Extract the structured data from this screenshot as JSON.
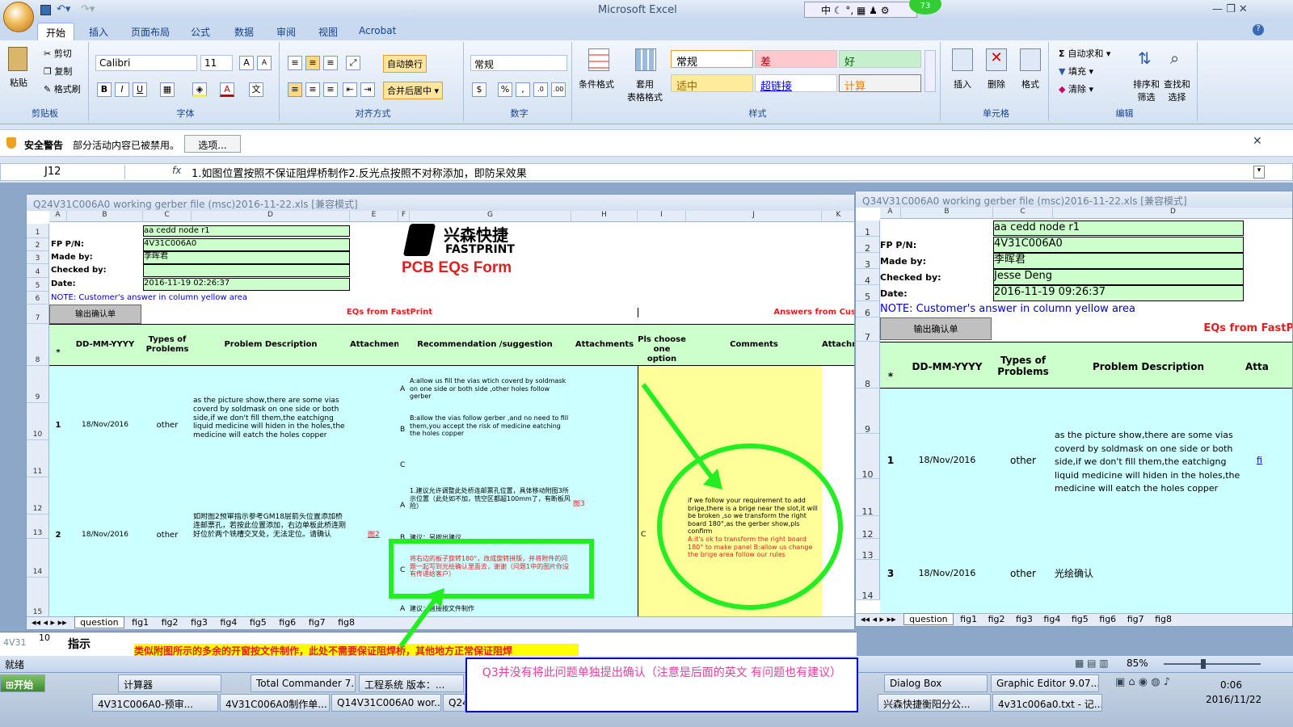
{
  "app": {
    "title": "Microsoft Excel",
    "help": "?"
  },
  "ime": {
    "label": "中",
    "badge": "73"
  },
  "tabs": [
    "开始",
    "插入",
    "页面布局",
    "公式",
    "数据",
    "审阅",
    "视图",
    "Acrobat"
  ],
  "ribbon": {
    "clipboard": {
      "label": "剪贴板",
      "paste": "粘贴",
      "cut": "剪切",
      "copy": "复制",
      "format_painter": "格式刷"
    },
    "font": {
      "label": "字体",
      "name": "Calibri",
      "size": "11"
    },
    "alignment": {
      "label": "对齐方式",
      "wrap": "自动换行",
      "merge": "合并后居中"
    },
    "number": {
      "label": "数字",
      "format": "常规"
    },
    "styles": {
      "label": "样式",
      "conditional": "条件格式",
      "table": "套用\n表格格式",
      "cells": [
        "常规",
        "差",
        "好",
        "适中",
        "超链接",
        "计算"
      ]
    },
    "cells_group": {
      "label": "单元格",
      "insert": "插入",
      "delete": "删除",
      "format": "格式"
    },
    "editing": {
      "label": "编辑",
      "autosum": "自动求和",
      "fill": "填充",
      "clear": "清除",
      "sort": "排序和\n筛选",
      "find": "查找和\n选择"
    }
  },
  "security": {
    "title": "安全警告",
    "text": "部分活动内容已被禁用。",
    "button": "选项..."
  },
  "formula_bar": {
    "name_box": "J12",
    "fx": "fx",
    "formula": "1.如图位置按照不保证阻焊桥制作2.反光点按照不对称添加，即防呆效果"
  },
  "left_window": {
    "title": "Q24V31C006A0 working gerber file (msc)2016-11-22.xls  [兼容模式]",
    "cols": [
      "A",
      "B",
      "C",
      "D",
      "E",
      "F",
      "G",
      "H",
      "I",
      "J",
      "K"
    ],
    "rows": [
      "1",
      "2",
      "3",
      "4",
      "5",
      "6",
      "7",
      "8",
      "9",
      "10",
      "11",
      "12",
      "13",
      "14",
      "15"
    ],
    "part_no": "aa cedd node r1",
    "fp_label": "FP P/N:",
    "fp_value": "4V31C006A0",
    "made_label": "Made by:",
    "made_value": "李晖君",
    "checked_label": "Checked by:",
    "date_label": "Date:",
    "date_value": "2016-11-19 02:26:37",
    "note": "NOTE: Customer's  answer in column yellow area",
    "logo_cn": "兴森快捷",
    "logo_en": "FASTPRINT",
    "form_title": "PCB EQs Form",
    "output_confirm": "输出确认单",
    "eqs_from": "EQs from FastPrint",
    "answers_from": "Answers from Cus",
    "headers": {
      "star": "*",
      "date": "DD-MM-YYYY",
      "types": "Types of Problems",
      "desc": "Problem Description",
      "attach": "Attachment",
      "rec": "Recommendation /suggestion",
      "attachments": "Attachments",
      "choose": "Pls choose one option",
      "comments": "Comments",
      "attach2": "Attachm"
    },
    "q1": {
      "no": "1",
      "date": "18/Nov/2016",
      "type": "other",
      "desc": "as the picture show,there are some vias coverd by soldmask on one side or both side,if we don't fill them,the eatchigng liquid medicine will hiden in the holes,the medicine will eatch the holes copper",
      "optA": "A:allow us fill the vias wtich coverd by soldmask on one side or both side ,other holes follow gerber",
      "optB": "B:allow the vias follow gerber ,and no need to fill them,you accept the risk of medicine eatching the holes copper"
    },
    "q2": {
      "no": "2",
      "date": "18/Nov/2016",
      "type": "other",
      "desc": "如附图2预审指示参考GM18层箭头位置添加桥连邮票孔，若按此位置添加，右边单板此桥连刚好位於两个铣槽交叉处，无法定位。请确认",
      "attach": "图2",
      "optA": "1.建议允许调整此处桥连邮票孔位置，具体移动附图3所示位置（此处如不加，铣空区都超100mm了，有断板风险）",
      "attachA": "图3",
      "optB": "建议：另按出建议",
      "optC": "将右边的板子旋转180°，改成旋转拼版，并将附件的问题一起写到光绘确认里面去，谢谢（问题1中的图片你没有传递给客户）",
      "choice": "C",
      "comment_black": "if we follow your requirement  to add brige,there is a brige near the slot,it will be broken ,so we transform the right board 180°,as the gerber show,pls confirm",
      "comment_red": "A:it's ok to transform the right board 180° to make panel  B:allow us change the brige area follow our rules"
    },
    "q3": {
      "optA": "建议：直接按文件制作"
    },
    "letters": [
      "A",
      "B",
      "C"
    ],
    "sheets": [
      "question",
      "fig1",
      "fig2",
      "fig3",
      "fig4",
      "fig5",
      "fig6",
      "fig7",
      "fig8"
    ]
  },
  "right_window": {
    "title": "Q34V31C006A0 working gerber file (msc)2016-11-22.xls  [兼容模式]",
    "cols": [
      "A",
      "B",
      "C",
      "D"
    ],
    "rows": [
      "1",
      "2",
      "3",
      "4",
      "5",
      "6",
      "7",
      "8",
      "9",
      "10",
      "11",
      "12",
      "13",
      "14"
    ],
    "part_no": "aa cedd node r1",
    "fp_label": "FP P/N:",
    "fp_value": "4V31C006A0",
    "made_label": "Made by:",
    "made_value": "李晖君",
    "checked_label": "Checked by:",
    "checked_value": "Jesse Deng",
    "date_label": "Date:",
    "date_value": "2016-11-19 09:26:37",
    "note": "NOTE: Customer's  answer in column yellow area",
    "output_confirm": "输出确认单",
    "eqs_from": "EQs from FastP",
    "headers": {
      "star": "*",
      "date": "DD-MM-YYYY",
      "types": "Types of Problems",
      "desc": "Problem Description",
      "attach": "Atta"
    },
    "q1": {
      "no": "1",
      "date": "18/Nov/2016",
      "type": "other",
      "desc": "as the picture show,there are some vias coverd by soldmask on one side or both side,if we don't fill them,the eatchigng liquid medicine will hiden in the holes,the medicine will eatch the holes copper",
      "attach": "fi"
    },
    "q3": {
      "no": "3",
      "date": "18/Nov/2016",
      "type": "other",
      "desc": "光绘确认"
    },
    "sheets": [
      "question",
      "fig1",
      "fig2",
      "fig3",
      "fig4",
      "fig5",
      "fig6",
      "fig7",
      "fig8"
    ]
  },
  "back_window": {
    "tab_label": "4V31",
    "row": "10",
    "label": "指示",
    "text": "类似附图所示的多余的开窗按文件制作，此处不需要保证阻焊桥，其他地方正常保证阻焊"
  },
  "annotation": "Q3并没有将此问题单独提出确认（注意是后面的英文   有问题也有建议）",
  "status": {
    "ready": "就绪",
    "zoom": "85%"
  },
  "taskbar": {
    "start": "开始",
    "row1": [
      "计算器",
      "Total Commander 7...",
      "工程系统  版本：...",
      "Dialog Box",
      "Graphic Editor 9.07..."
    ],
    "row2": [
      "4V31C006A0-预审...",
      "4V31C006A0制作单...",
      "Q14V31C006A0 wor...",
      "Q24V",
      "兴森快捷衡阳分公...",
      "4v31c006a0.txt - 记..."
    ],
    "time": "0:06",
    "date": "2016/11/22"
  },
  "colors": {
    "accent": "#15428b",
    "annotation_green": "#22ee22",
    "annotation_blue": "#0000cc"
  }
}
